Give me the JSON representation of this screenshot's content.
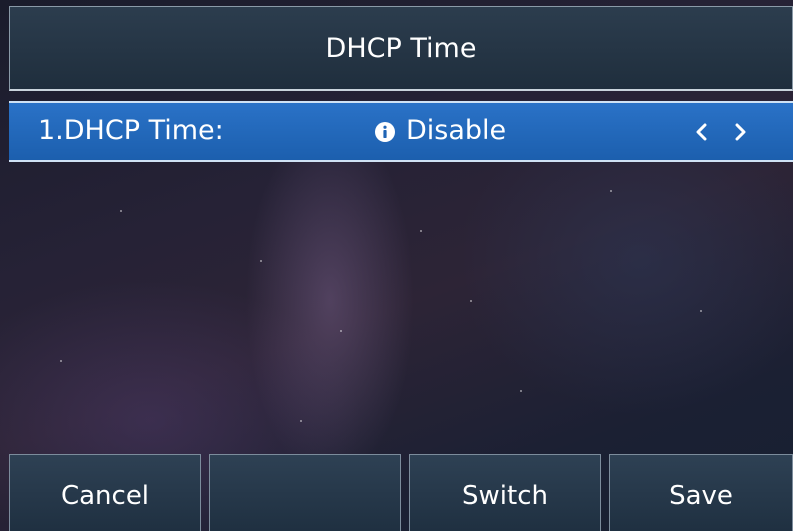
{
  "header": {
    "title": "DHCP Time"
  },
  "menu": {
    "items": [
      {
        "label": "1.DHCP Time:",
        "value": "Disable",
        "icon": "info-icon",
        "selected": true
      }
    ]
  },
  "softkeys": [
    {
      "label": "Cancel"
    },
    {
      "label": ""
    },
    {
      "label": "Switch"
    },
    {
      "label": "Save"
    }
  ],
  "colors": {
    "selected_row": "#2a72c7",
    "title_bar": "#2c3d4e",
    "softkey_bg": "#2e4154",
    "text": "#ffffff"
  }
}
